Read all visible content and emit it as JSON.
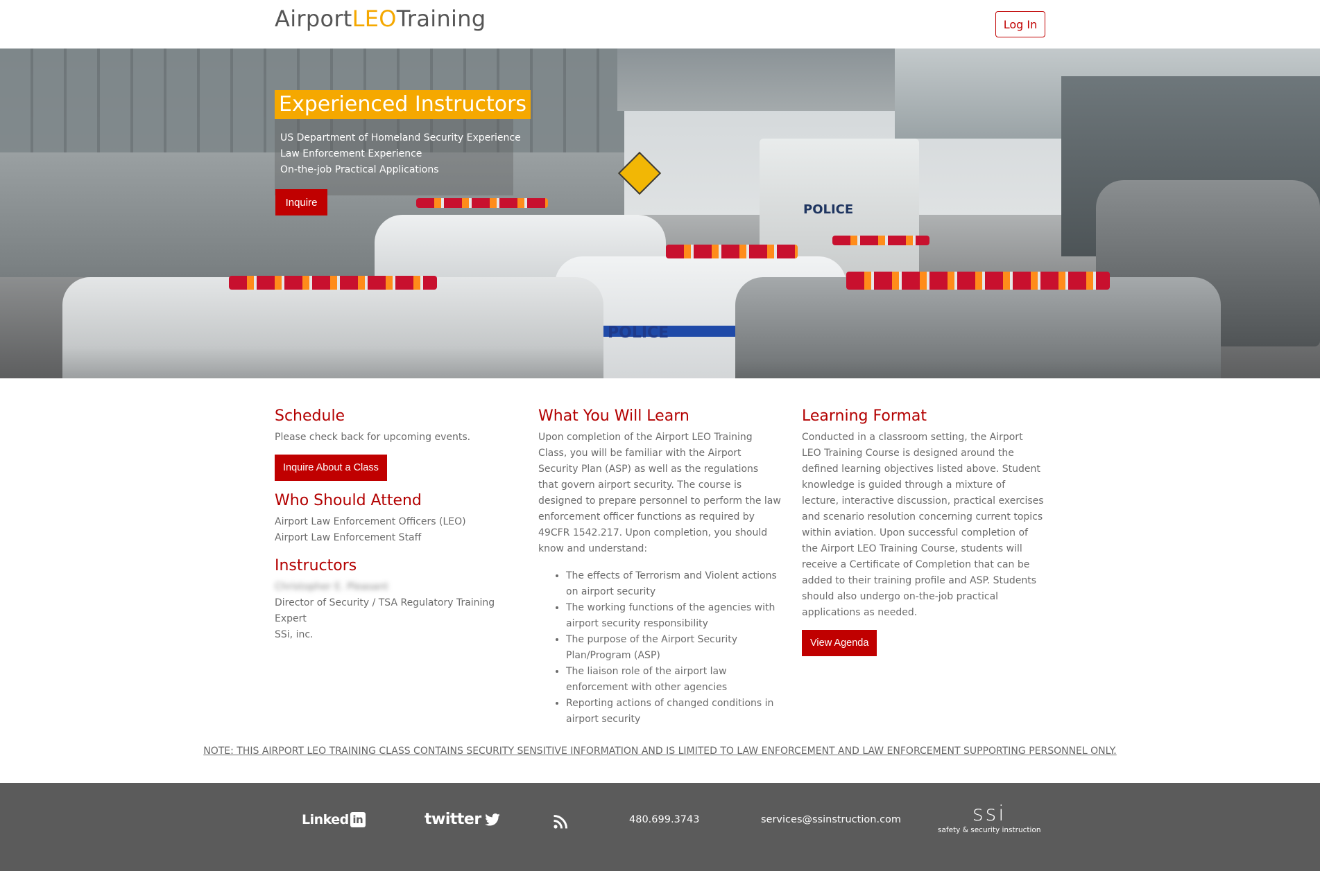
{
  "brand": {
    "prefix": "Airport",
    "accent": "LEO",
    "suffix": "Training",
    "accent_color": "#f5a800"
  },
  "nav": {
    "login_label": "Log In"
  },
  "hero": {
    "title": "Experienced Instructors",
    "lines": [
      "US Department of Homeland Security Experience",
      "Law Enforcement Experience",
      "On-the-job Practical Applications"
    ],
    "inquire_label": "Inquire",
    "background_image": "police-cars-at-airport-terminal",
    "vehicle_labels": [
      "POLICE",
      "POLICE"
    ]
  },
  "schedule": {
    "heading": "Schedule",
    "text": "Please check back for upcoming events.",
    "button_label": "Inquire About a Class"
  },
  "who": {
    "heading": "Who Should Attend",
    "items": [
      "Airport Law Enforcement Officers (LEO)",
      "Airport Law Enforcement Staff"
    ]
  },
  "instructors": {
    "heading": "Instructors",
    "name": "Christopher E. Pleasant",
    "title": "Director of Security / TSA Regulatory Training Expert",
    "company": "SSi, inc."
  },
  "learn": {
    "heading": "What You Will Learn",
    "intro": "Upon completion of the Airport LEO Training Class, you will be familiar with the Airport Security Plan (ASP) as well as the regulations that govern airport security. The course is designed to prepare personnel to perform the law enforcement officer functions as required by 49CFR 1542.217. Upon completion, you should know and understand:",
    "items": [
      "The effects of Terrorism and Violent actions on airport security",
      "The working functions of the agencies with airport security responsibility",
      "The purpose of the Airport Security Plan/Program (ASP)",
      "The liaison role of the airport law enforcement with other agencies",
      "Reporting actions of changed conditions in airport security"
    ]
  },
  "format": {
    "heading": "Learning Format",
    "text": "Conducted in a classroom setting, the Airport LEO Training Course is designed around the defined learning objectives listed above. Student knowledge is guided through a mixture of lecture, interactive discussion, practical exercises and scenario resolution concerning current topics within aviation. Upon successful completion of the Airport LEO Training Course, students will receive a Certificate of Completion that can be added to their training profile and ASP. Students should also undergo on-the-job practical applications as needed.",
    "button_label": "View Agenda"
  },
  "note": "NOTE: THIS AIRPORT LEO TRAINING CLASS CONTAINS SECURITY SENSITIVE INFORMATION AND IS LIMITED TO LAW ENFORCEMENT AND LAW ENFORCEMENT SUPPORTING PERSONNEL ONLY.",
  "footer": {
    "linkedin_text": "Linked",
    "linkedin_badge": "in",
    "twitter_text": "twitter",
    "phone": "480.699.3743",
    "email": "services@ssinstruction.com",
    "logo_mark": "ssi",
    "logo_tagline": "safety & security instruction",
    "icons": [
      "linkedin-icon",
      "twitter-icon",
      "rss-icon",
      "ssi-logo"
    ]
  },
  "colors": {
    "primary_red": "#c00000",
    "heading_red": "#b30000",
    "footer_bg": "#5b5b5b"
  }
}
